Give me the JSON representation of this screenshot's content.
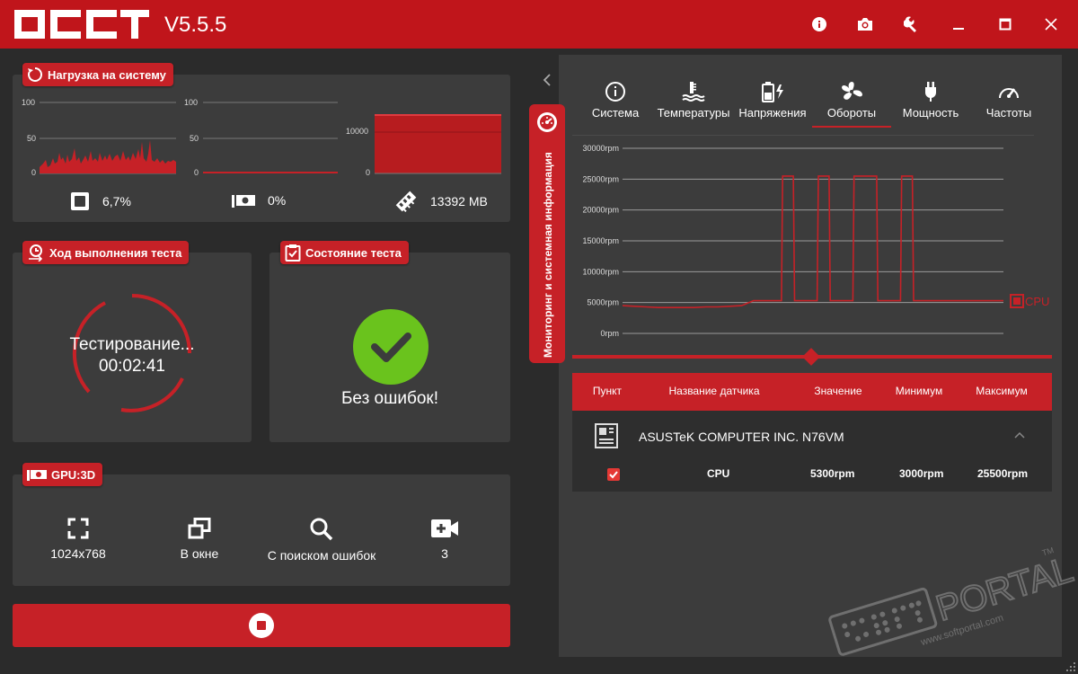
{
  "app": {
    "version": "V5.5.5"
  },
  "load_panel": {
    "title": "Нагрузка на систему",
    "cpu_axis": [
      "100",
      "50",
      "0"
    ],
    "gpu_axis": [
      "100",
      "50",
      "0"
    ],
    "ram_axis": [
      "10000",
      "0"
    ],
    "cpu_value": "6,7%",
    "gpu_value": "0%",
    "ram_value": "13392 MB"
  },
  "progress_panel": {
    "title": "Ход выполнения теста",
    "status": "Тестирование...",
    "elapsed": "00:02:41"
  },
  "state_panel": {
    "title": "Состояние теста",
    "status": "Без ошибок!"
  },
  "gpu_panel": {
    "title": "GPU:3D",
    "resolution": "1024x768",
    "mode": "В окне",
    "error_check": "С поиском ошибок",
    "complexity": "3"
  },
  "side_tab": {
    "label": "Мониторинг и системная информация"
  },
  "tabs": [
    {
      "label": "Система"
    },
    {
      "label": "Температуры"
    },
    {
      "label": "Напряжения"
    },
    {
      "label": "Обороты"
    },
    {
      "label": "Мощность"
    },
    {
      "label": "Частоты"
    }
  ],
  "active_tab": "Обороты",
  "chart_data": {
    "type": "line",
    "y_ticks": [
      "30000rpm",
      "25000rpm",
      "20000rpm",
      "15000rpm",
      "10000rpm",
      "5000rpm",
      "0rpm"
    ],
    "ylim": [
      0,
      30000
    ],
    "series": [
      {
        "name": "CPU",
        "color": "#c62127",
        "values": [
          4500,
          4400,
          4300,
          4200,
          4200,
          4200,
          4200,
          4300,
          4300,
          4400,
          4500,
          5300,
          5300,
          5300,
          25500,
          5300,
          5300,
          25500,
          5300,
          5300,
          25500,
          25500,
          5300,
          5300,
          25500,
          5300,
          5300,
          5300,
          5300,
          5300,
          5300,
          5300,
          5300
        ]
      }
    ]
  },
  "table": {
    "headers": [
      "Пункт",
      "Название датчика",
      "Значение",
      "Минимум",
      "Максимум"
    ],
    "group": "ASUSTeK COMPUTER INC. N76VM",
    "rows": [
      {
        "name": "CPU",
        "value": "5300rpm",
        "min": "3000rpm",
        "max": "25500rpm",
        "checked": true
      }
    ]
  },
  "watermark": {
    "brand": "PORTAL",
    "url": "www.softportal.com",
    "tm": "TM"
  }
}
